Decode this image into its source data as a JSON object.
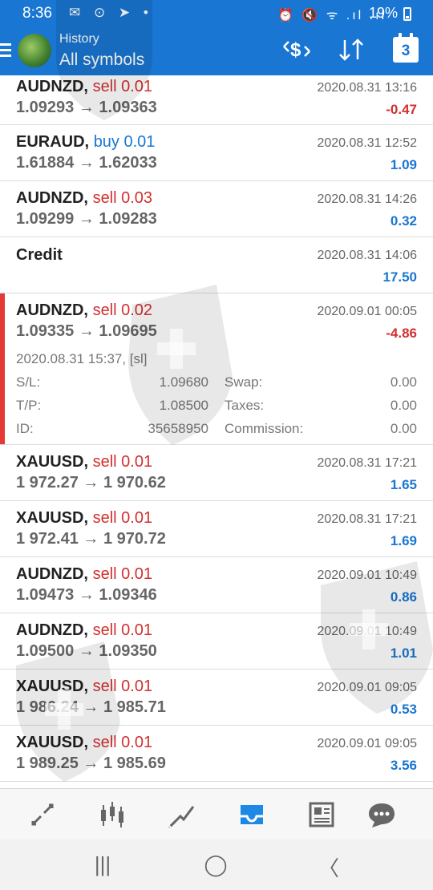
{
  "status_bar": {
    "time": "8:36",
    "left_icons": "✉ ⊙ ➤ •",
    "right_icons": "⏰ 🔇 ᯤ .ıl .ıl",
    "battery": "19%"
  },
  "app_bar": {
    "title": "History",
    "subtitle": "All symbols",
    "calendar_day": "3",
    "icons": [
      "menu-icon",
      "deposit-icon",
      "sort-icon",
      "calendar-icon"
    ]
  },
  "trades": [
    {
      "symbol": "AUDNZD,",
      "side": "sell 0.01",
      "side_type": "sell",
      "prices": "1.09293 → 1.09363",
      "time": "2020.08.31 13:16",
      "profit": "-0.47",
      "profit_sign": "neg"
    },
    {
      "symbol": "EURAUD,",
      "side": "buy 0.01",
      "side_type": "buy",
      "prices": "1.61884 → 1.62033",
      "time": "2020.08.31 12:52",
      "profit": "1.09",
      "profit_sign": "pos"
    },
    {
      "symbol": "AUDNZD,",
      "side": "sell 0.03",
      "side_type": "sell",
      "prices": "1.09299 → 1.09283",
      "time": "2020.08.31 14:26",
      "profit": "0.32",
      "profit_sign": "pos"
    },
    {
      "label": "Credit",
      "time": "2020.08.31 14:06",
      "profit": "17.50",
      "profit_sign": "pos"
    },
    {
      "symbol": "AUDNZD,",
      "side": "sell 0.02",
      "side_type": "sell",
      "prices": "1.09335 → 1.09695",
      "time": "2020.09.01 00:05",
      "profit": "-4.86",
      "profit_sign": "neg",
      "details": {
        "open_time": "2020.08.31 15:37, [sl]",
        "sl_label": "S/L:",
        "sl": "1.09680",
        "tp_label": "T/P:",
        "tp": "1.08500",
        "id_label": "ID:",
        "id": "35658950",
        "swap_label": "Swap:",
        "swap": "0.00",
        "taxes_label": "Taxes:",
        "taxes": "0.00",
        "commission_label": "Commission:",
        "commission": "0.00"
      }
    },
    {
      "symbol": "XAUUSD,",
      "side": "sell 0.01",
      "side_type": "sell",
      "prices": "1 972.27 → 1 970.62",
      "time": "2020.08.31 17:21",
      "profit": "1.65",
      "profit_sign": "pos"
    },
    {
      "symbol": "XAUUSD,",
      "side": "sell 0.01",
      "side_type": "sell",
      "prices": "1 972.41 → 1 970.72",
      "time": "2020.08.31 17:21",
      "profit": "1.69",
      "profit_sign": "pos"
    },
    {
      "symbol": "AUDNZD,",
      "side": "sell 0.01",
      "side_type": "sell",
      "prices": "1.09473 → 1.09346",
      "time": "2020.09.01 10:49",
      "profit": "0.86",
      "profit_sign": "pos"
    },
    {
      "symbol": "AUDNZD,",
      "side": "sell 0.01",
      "side_type": "sell",
      "prices": "1.09500 → 1.09350",
      "time": "2020.09.01 10:49",
      "profit": "1.01",
      "profit_sign": "pos"
    },
    {
      "symbol": "XAUUSD,",
      "side": "sell 0.01",
      "side_type": "sell",
      "prices": "1 986.24 → 1 985.71",
      "time": "2020.09.01 09:05",
      "profit": "0.53",
      "profit_sign": "pos"
    },
    {
      "symbol": "XAUUSD,",
      "side": "sell 0.01",
      "side_type": "sell",
      "prices": "1 989.25 → 1 985.69",
      "time": "2020.09.01 09:05",
      "profit": "3.56",
      "profit_sign": "pos"
    }
  ],
  "bottom_nav": [
    {
      "name": "quotes-icon",
      "glyph": "⇅"
    },
    {
      "name": "chart-icon",
      "glyph": "┃┃┃"
    },
    {
      "name": "trade-icon",
      "glyph": "⤢"
    },
    {
      "name": "history-icon",
      "glyph": "📥",
      "active": true
    },
    {
      "name": "news-icon",
      "glyph": "📰"
    },
    {
      "name": "chat-icon",
      "glyph": "💬"
    }
  ],
  "system_nav": {
    "recents": "|||",
    "home": "◯",
    "back": "〈"
  },
  "colors": {
    "accent": "#1976d2",
    "sell": "#d32f2f",
    "loss": "#d32f2f",
    "profit": "#1976d2",
    "selection": "#e53935"
  }
}
